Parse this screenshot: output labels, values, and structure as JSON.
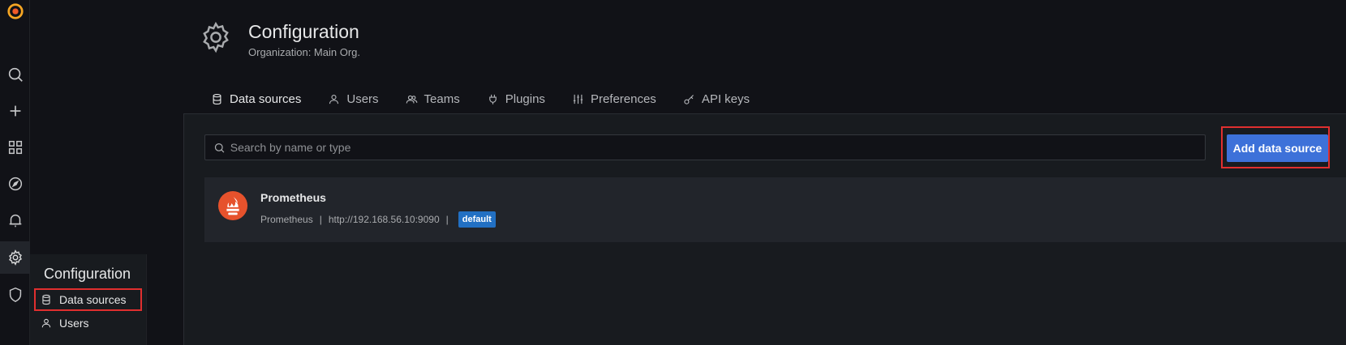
{
  "header": {
    "title": "Configuration",
    "subtitle": "Organization: Main Org."
  },
  "tabs": [
    {
      "label": "Data sources",
      "icon": "database-icon",
      "active": true
    },
    {
      "label": "Users",
      "icon": "user-icon",
      "active": false
    },
    {
      "label": "Teams",
      "icon": "users-icon",
      "active": false
    },
    {
      "label": "Plugins",
      "icon": "plug-icon",
      "active": false
    },
    {
      "label": "Preferences",
      "icon": "sliders-icon",
      "active": false
    },
    {
      "label": "API keys",
      "icon": "key-icon",
      "active": false
    }
  ],
  "search": {
    "placeholder": "Search by name or type",
    "value": ""
  },
  "add_button": {
    "label": "Add data source"
  },
  "datasources": [
    {
      "name": "Prometheus",
      "type": "Prometheus",
      "url": "http://192.168.56.10:9090",
      "separator": "|",
      "badge": "default"
    }
  ],
  "sidebar": {
    "icons": [
      "grafana-logo-icon",
      "search-icon",
      "plus-icon",
      "apps-icon",
      "compass-icon",
      "bell-icon",
      "gear-icon",
      "shield-icon"
    ],
    "active": "gear-icon"
  },
  "flyout": {
    "title": "Configuration",
    "items": [
      {
        "label": "Data sources",
        "icon": "database-icon"
      },
      {
        "label": "Users",
        "icon": "user-icon"
      }
    ]
  },
  "colors": {
    "accent_blue": "#3d71d9",
    "highlight_red": "#e02f2f",
    "tab_gradient_start": "#f05a28",
    "tab_gradient_end": "#fbca0a",
    "prometheus_orange": "#e6522c",
    "badge_blue": "#2270c3"
  }
}
